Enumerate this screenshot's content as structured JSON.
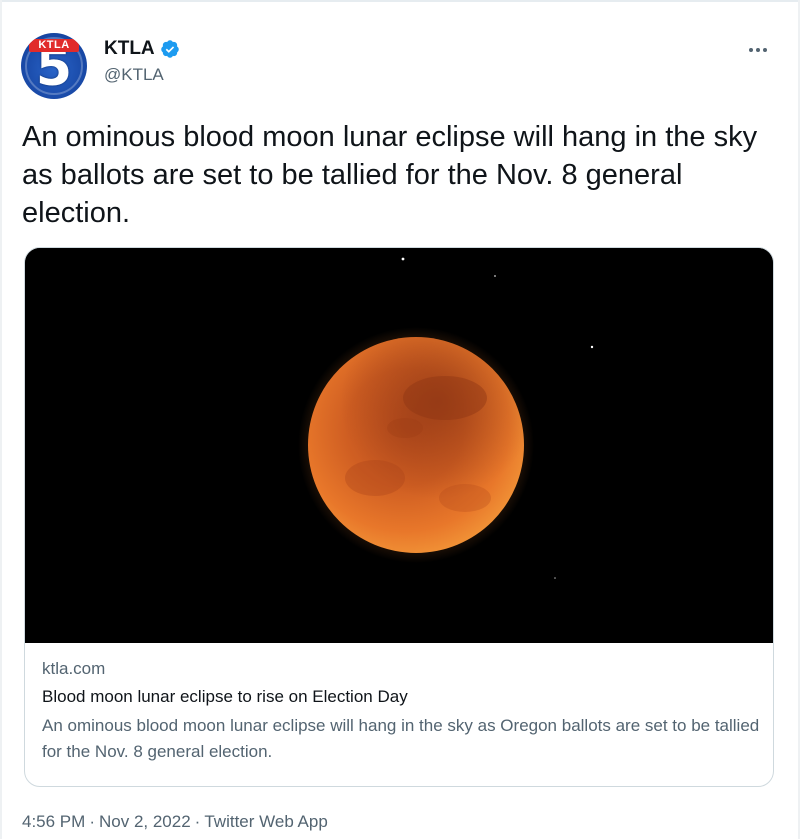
{
  "tweet": {
    "author": {
      "display_name": "KTLA",
      "handle": "@KTLA",
      "verified": true,
      "avatar_mark": "KTLA",
      "avatar_number": "5"
    },
    "more_icon": "more-horizontal-icon",
    "text": "An ominous blood moon lunar eclipse will hang in the sky as ballots are set to be tallied for the Nov. 8 general election.",
    "card": {
      "domain": "ktla.com",
      "title": "Blood moon lunar eclipse to rise on Election Day",
      "description": "An ominous blood moon lunar eclipse will hang in the sky as Oregon ballots are set to be tallied for the Nov. 8 general election."
    },
    "meta": {
      "time": "4:56 PM",
      "date": "Nov 2, 2022",
      "source": "Twitter Web App",
      "separator": "·"
    }
  },
  "colors": {
    "verified_blue": "#1d9bf0",
    "secondary_text": "#536471",
    "primary_text": "#0f1419",
    "border": "#cfd9de",
    "moon_orange": "#e2702a"
  }
}
